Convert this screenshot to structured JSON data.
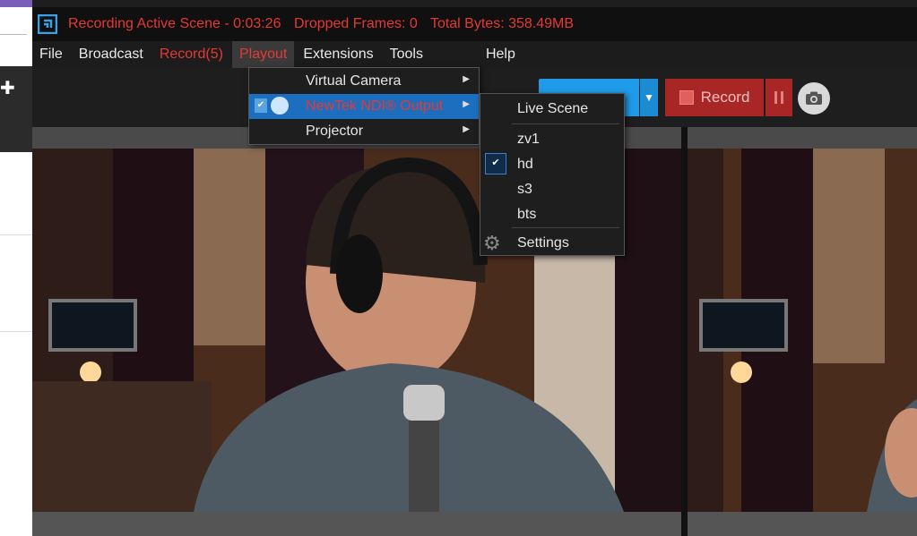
{
  "title_bar": {
    "status": "Recording Active Scene - 0:03:26",
    "dropped": "Dropped Frames: 0",
    "bytes": "Total Bytes: 358.49MB"
  },
  "menu": {
    "file": "File",
    "broadcast": "Broadcast",
    "record": "Record(5)",
    "playout": "Playout",
    "extensions": "Extensions",
    "tools": "Tools",
    "help": "Help"
  },
  "playout_menu": {
    "virtual_camera": "Virtual Camera",
    "ndi_output": "NewTek NDI® Output",
    "projector": "Projector"
  },
  "ndi_submenu": {
    "live_scene": "Live Scene",
    "items": [
      "zv1",
      "hd",
      "s3",
      "bts"
    ],
    "checked": "hd",
    "settings": "Settings"
  },
  "toolbar": {
    "record_label": "Record"
  },
  "colors": {
    "accent_red": "#e53935",
    "stream_blue": "#1e9be9",
    "record_red": "#a92626",
    "menu_highlight": "#1c6fbf"
  }
}
